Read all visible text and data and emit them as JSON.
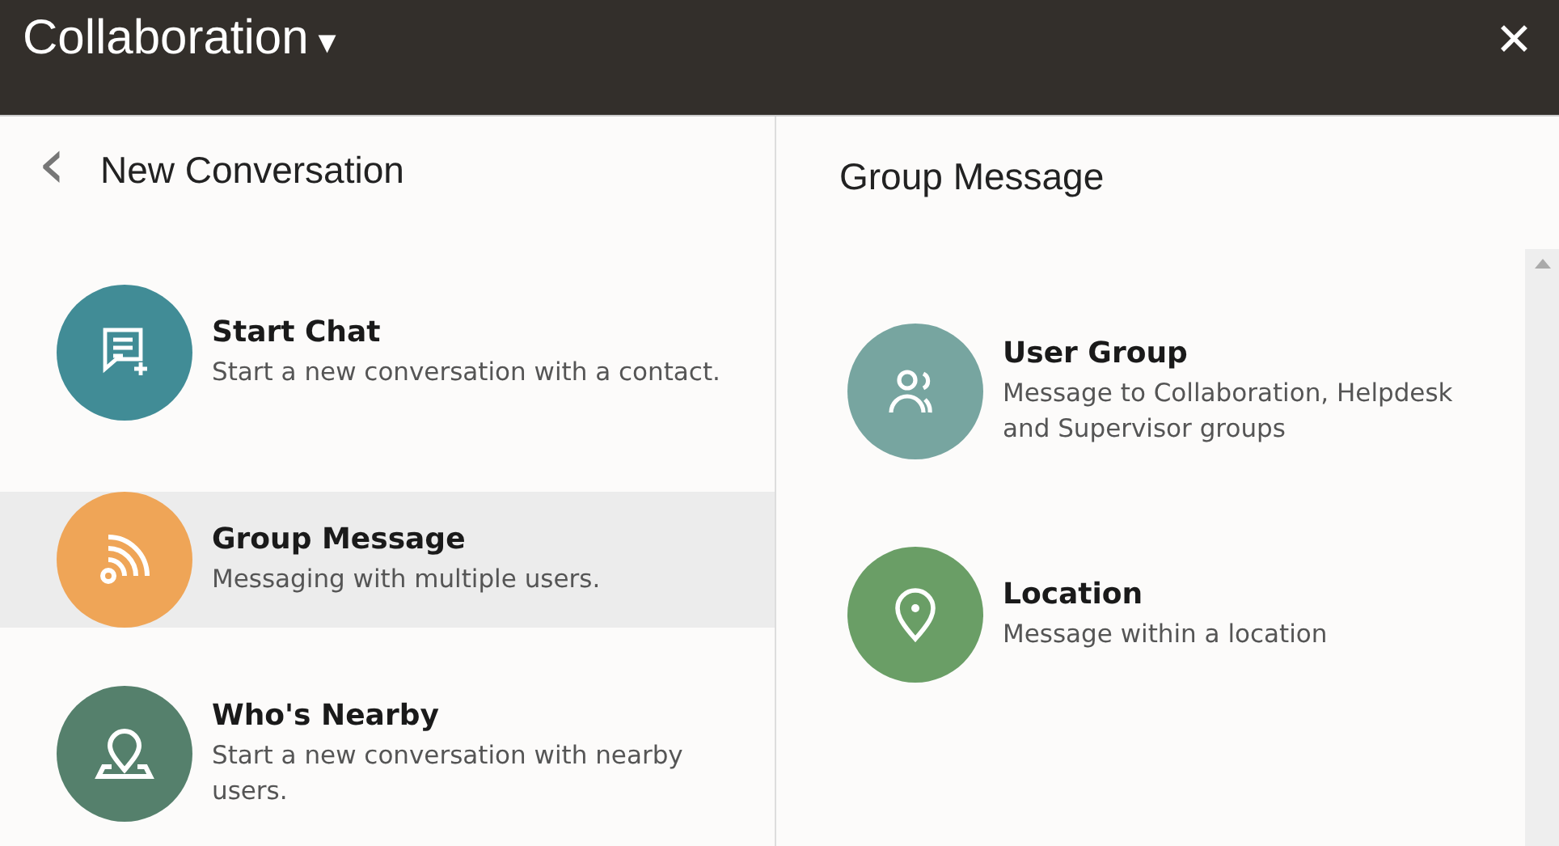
{
  "header": {
    "title": "Collaboration",
    "menu_caret": "▾",
    "close": "✕"
  },
  "left_panel": {
    "back": "‹",
    "title": "New Conversation",
    "items": [
      {
        "kind": "chat",
        "title": "Start Chat",
        "description": "Start a new conversation with a contact.",
        "color": "#418c96",
        "selected": false
      },
      {
        "kind": "rss",
        "title": "Group Message",
        "description": "Messaging with multiple users.",
        "color": "#efa557",
        "selected": true
      },
      {
        "kind": "nearby",
        "title": "Who's Nearby",
        "description": "Start a new conversation with nearby users.",
        "color": "#55806c",
        "selected": false
      }
    ]
  },
  "right_panel": {
    "title": "Group Message",
    "items": [
      {
        "kind": "users",
        "title": "User Group",
        "description": "Message to Collaboration, Helpdesk and Supervisor groups",
        "color": "#77a5a0",
        "selected": false
      },
      {
        "kind": "pin",
        "title": "Location",
        "description": "Message within a location",
        "color": "#6a9e66",
        "selected": false
      }
    ]
  }
}
